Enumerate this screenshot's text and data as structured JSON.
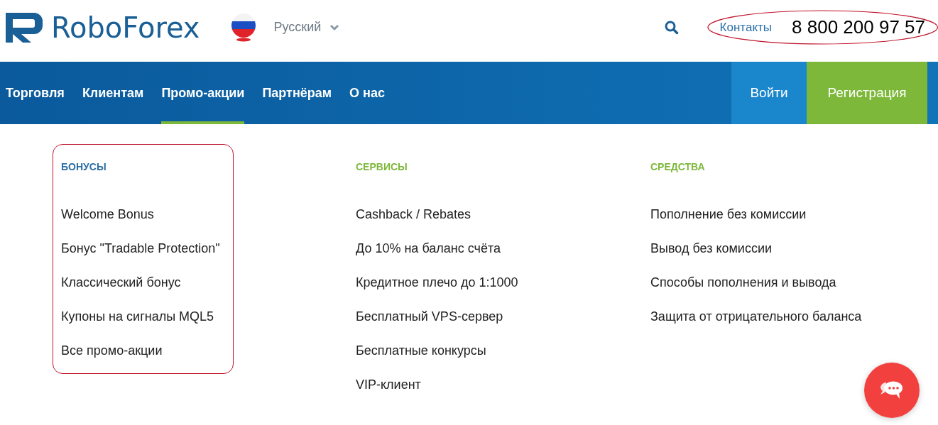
{
  "header": {
    "logo": "RoboForex",
    "language": "Русский",
    "contacts_link": "Контакты",
    "phone": "8 800 200 97 57",
    "contacts_highlighted": true
  },
  "nav": {
    "items": [
      {
        "label": "Торговля",
        "selected": false
      },
      {
        "label": "Клиентам",
        "selected": false
      },
      {
        "label": "Промо-акции",
        "selected": true
      },
      {
        "label": "Партнёрам",
        "selected": false
      },
      {
        "label": "О нас",
        "selected": false
      }
    ],
    "login_button": "Войти",
    "register_button": "Регистрация"
  },
  "menu": {
    "columns": [
      {
        "heading": "БОНУСЫ",
        "color": "#2a6fa6",
        "highlighted": true,
        "items": [
          "Welcome Bonus",
          "Бонус \"Tradable Protection\"",
          "Классический бонус",
          "Купоны на сигналы MQL5",
          "Все промо-акции"
        ]
      },
      {
        "heading": "СЕРВИСЫ",
        "color": "#7db83a",
        "highlighted": false,
        "items": [
          "Cashback / Rebates",
          "До 10% на баланс счёта",
          "Кредитное плечо до 1:1000",
          "Бесплатный VPS-сервер",
          "Бесплатные конкурсы",
          "VIP-клиент"
        ]
      },
      {
        "heading": "СРЕДСТВА",
        "color": "#7db83a",
        "highlighted": false,
        "items": [
          "Пополнение без комиссии",
          "Вывод без комиссии",
          "Способы пополнения и вывода",
          "Защита от отрицательного баланса"
        ]
      }
    ]
  }
}
